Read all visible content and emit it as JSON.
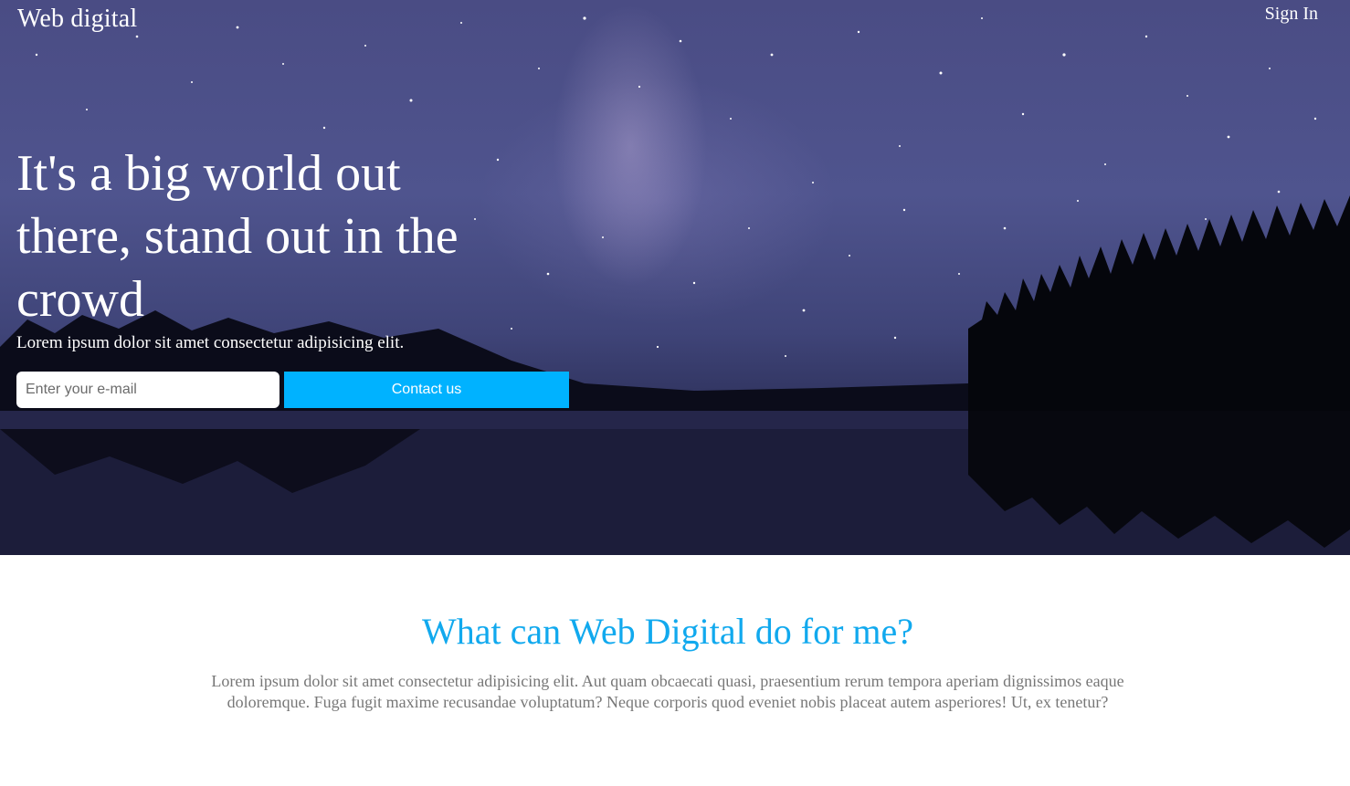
{
  "header": {
    "brand": "Web digital",
    "signin_label": "Sign In"
  },
  "hero": {
    "title": "It's a big world out there, stand out in the crowd",
    "subtitle": "Lorem ipsum dolor sit amet consectetur adipisicing elit.",
    "email_placeholder": "Enter your e-mail",
    "contact_label": "Contact us",
    "background_image": "starry-night-lake-image"
  },
  "about": {
    "title": "What can Web Digital do for me?",
    "text": "Lorem ipsum dolor sit amet consectetur adipisicing elit. Aut quam obcaecati quasi, praesentium rerum tempora aperiam dignissimos eaque doloremque. Fuga fugit maxime recusandae voluptatum? Neque corporis quod eveniet nobis placeat autem asperiores! Ut, ex tenetur?"
  },
  "colors": {
    "accent": "#00b2ff",
    "section_title": "#11a9ee",
    "body_text": "#777777"
  }
}
